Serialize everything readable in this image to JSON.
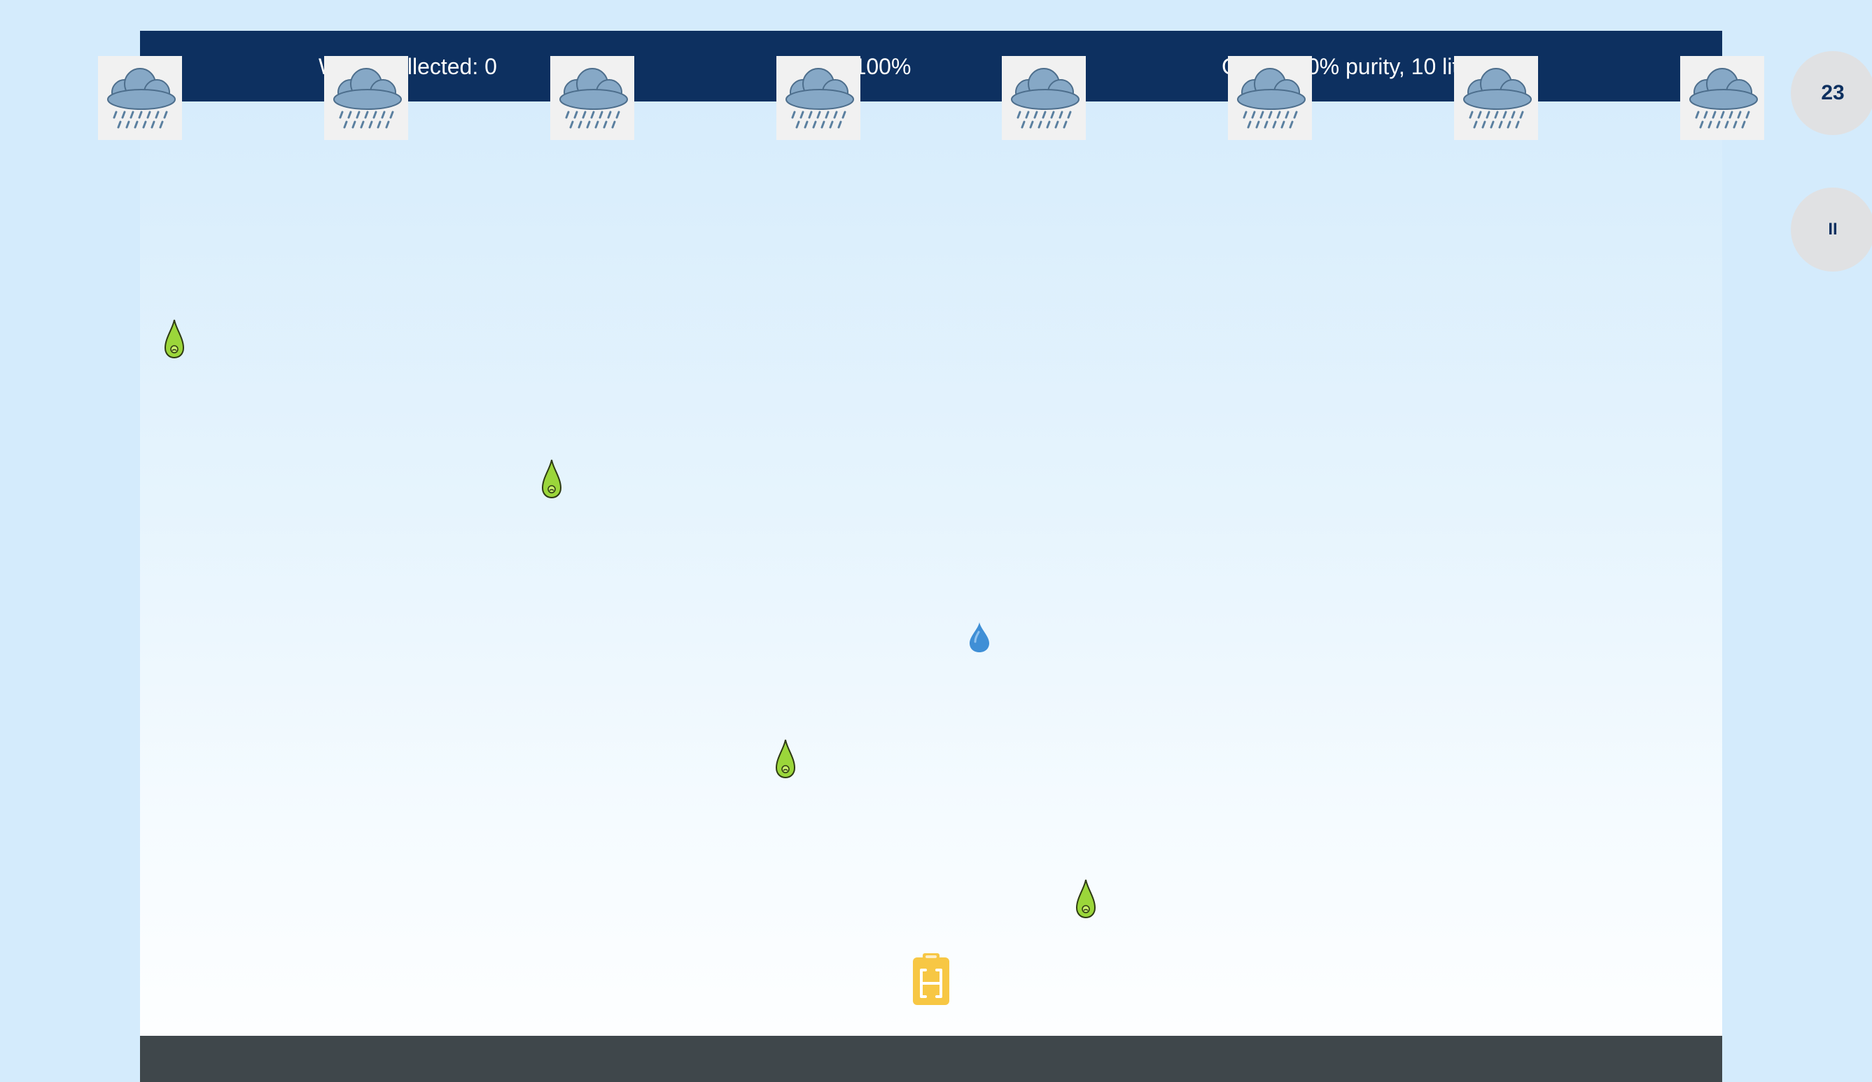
{
  "hud": {
    "water_collected": "Water collected: 0",
    "purity": "Purity: 100%",
    "goal": "Goal: >80% purity, 10 liters"
  },
  "timer": "23",
  "pause_label": "II",
  "icons": {
    "cloud": "rain-cloud-icon",
    "clean_drop": "clean-water-drop-icon",
    "polluted_drop": "polluted-drop-icon",
    "collector": "jerry-can-icon",
    "pause": "pause-icon"
  },
  "colors": {
    "hud_background": "#0d3060",
    "sky_top": "#d4ebfc",
    "ground": "#3f474b",
    "clean_drop": "#3f8fd6",
    "polluted_drop": "#9bd63a",
    "collector": "#f7c744"
  },
  "clouds": [
    {
      "name": "cloud-1"
    },
    {
      "name": "cloud-2"
    },
    {
      "name": "cloud-3"
    },
    {
      "name": "cloud-4"
    },
    {
      "name": "cloud-5"
    },
    {
      "name": "cloud-6"
    },
    {
      "name": "cloud-7"
    },
    {
      "name": "cloud-8"
    }
  ],
  "drops": [
    {
      "type": "polluted"
    },
    {
      "type": "polluted"
    },
    {
      "type": "clean"
    },
    {
      "type": "polluted"
    },
    {
      "type": "polluted"
    }
  ]
}
